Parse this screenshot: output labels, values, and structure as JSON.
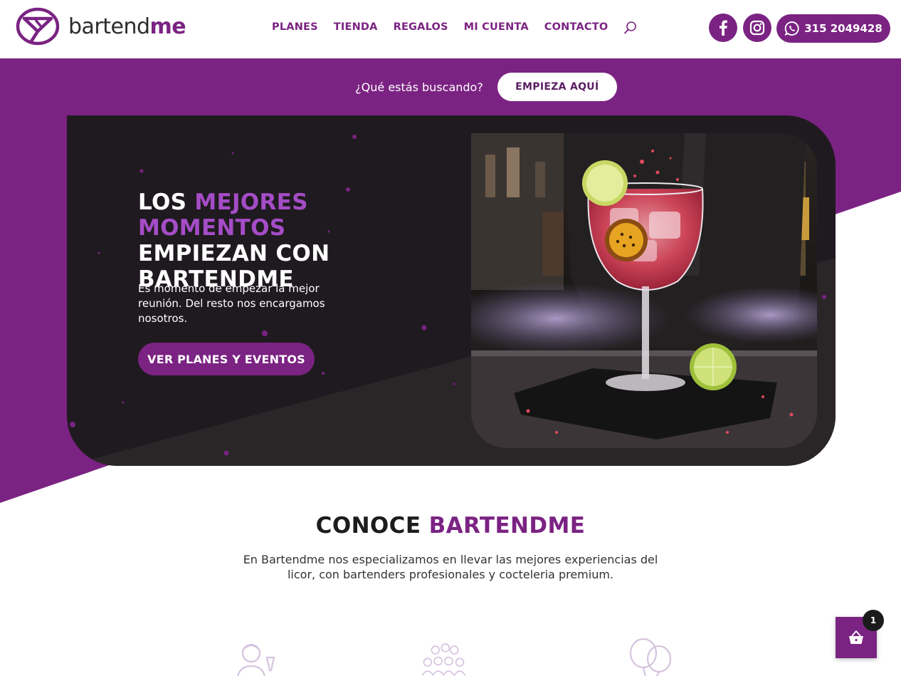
{
  "brand": {
    "logo_text_main": "bartend",
    "logo_text_accent": "me",
    "color_primary": "#7b2383",
    "color_highlight": "#a54cc7",
    "color_dark": "#1f1a1f"
  },
  "nav": {
    "items": [
      {
        "label": "PLANES"
      },
      {
        "label": "TIENDA"
      },
      {
        "label": "REGALOS"
      },
      {
        "label": "MI CUENTA"
      },
      {
        "label": "CONTACTO"
      }
    ],
    "search_icon": "search-icon"
  },
  "social": {
    "facebook_icon": "facebook-icon",
    "instagram_icon": "instagram-icon",
    "whatsapp_icon": "whatsapp-icon",
    "phone": "315 2049428"
  },
  "search_prompt": {
    "question": "¿Qué estás buscando?",
    "button_label": "EMPIEZA AQUÍ"
  },
  "hero": {
    "title_part1": "LOS ",
    "title_highlight": "MEJORES MOMENTOS",
    "title_part2": " EMPIEZAN CON BARTENDME",
    "subtitle": "Es momento de empezar la mejor reunión. Del resto nos encargamos nosotros.",
    "cta_label": "VER PLANES Y EVENTOS",
    "photo_subject": "cocktail-glass-photo"
  },
  "about": {
    "title_part1": "CONOCE ",
    "title_highlight": "BARTENDME",
    "text": "En Bartendme nos especializamos en llevar las mejores experiencias del licor, con bartenders profesionales y cocteleria premium.",
    "feature_icons": [
      "bartender-icon",
      "crowd-icon",
      "balloons-icon"
    ]
  },
  "cart": {
    "icon": "shopping-basket-icon",
    "count": "1"
  }
}
